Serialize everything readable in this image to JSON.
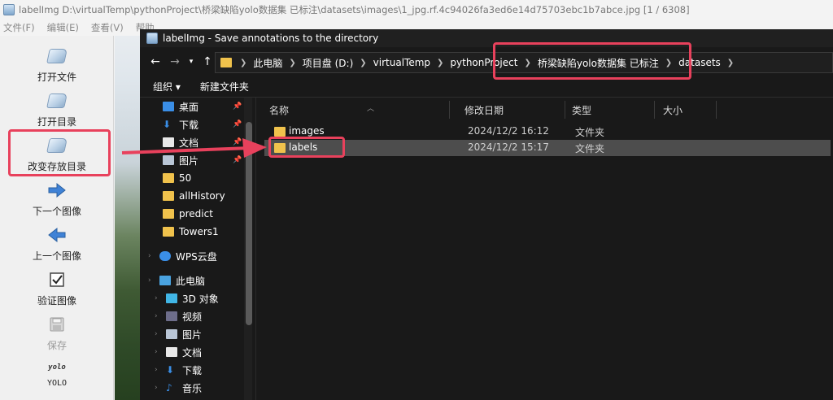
{
  "main_window": {
    "title": "labelImg D:\\virtualTemp\\pythonProject\\桥梁缺陷yolo数据集 已标注\\datasets\\images\\1_jpg.rf.4c94026fa3ed6e14d75703ebc1b7abce.jpg [1 / 6308]",
    "menu": [
      "文件(F)",
      "编辑(E)",
      "查看(V)",
      "帮助"
    ]
  },
  "toolbar": {
    "items": [
      {
        "label": "打开文件",
        "icon": "folder-open-icon"
      },
      {
        "label": "打开目录",
        "icon": "folder-open-icon"
      },
      {
        "label": "改变存放目录",
        "icon": "folder-open-icon"
      },
      {
        "label": "下一个图像",
        "icon": "arrow-right-icon"
      },
      {
        "label": "上一个图像",
        "icon": "arrow-left-icon"
      },
      {
        "label": "验证图像",
        "icon": "checkbox-icon"
      },
      {
        "label": "保存",
        "icon": "save-icon"
      },
      {
        "label": "YOLO",
        "icon": "yolo-format-icon",
        "icon_text": "yolo"
      }
    ]
  },
  "dialog": {
    "title": "labelImg - Save annotations to the directory",
    "breadcrumbs": [
      "此电脑",
      "项目盘 (D:)",
      "virtualTemp",
      "pythonProject",
      "桥梁缺陷yolo数据集 已标注",
      "datasets"
    ],
    "commands": {
      "organize": "组织 ▾",
      "new_folder": "新建文件夹"
    },
    "nav_pane": [
      {
        "label": "桌面",
        "icon": "desktop-icon",
        "pinned": true
      },
      {
        "label": "下载",
        "icon": "download-icon",
        "pinned": true
      },
      {
        "label": "文档",
        "icon": "document-icon",
        "pinned": true
      },
      {
        "label": "图片",
        "icon": "pictures-icon",
        "pinned": true
      },
      {
        "label": "50",
        "icon": "folder-icon"
      },
      {
        "label": "allHistory",
        "icon": "folder-icon"
      },
      {
        "label": "predict",
        "icon": "folder-icon"
      },
      {
        "label": "Towers1",
        "icon": "folder-icon"
      },
      {
        "label": "WPS云盘",
        "icon": "cloud-icon"
      },
      {
        "label": "此电脑",
        "icon": "computer-icon"
      },
      {
        "label": "3D 对象",
        "icon": "cube-icon"
      },
      {
        "label": "视频",
        "icon": "video-icon"
      },
      {
        "label": "图片",
        "icon": "pictures-icon"
      },
      {
        "label": "文档",
        "icon": "document-icon"
      },
      {
        "label": "下载",
        "icon": "download-icon"
      },
      {
        "label": "音乐",
        "icon": "music-icon"
      }
    ],
    "columns": [
      "名称",
      "修改日期",
      "类型",
      "大小"
    ],
    "rows": [
      {
        "name": "images",
        "modified": "2024/12/2 16:12",
        "type": "文件夹",
        "selected": false
      },
      {
        "name": "labels",
        "modified": "2024/12/2 15:17",
        "type": "文件夹",
        "selected": true
      }
    ]
  },
  "annotation_color": "#e8415c"
}
